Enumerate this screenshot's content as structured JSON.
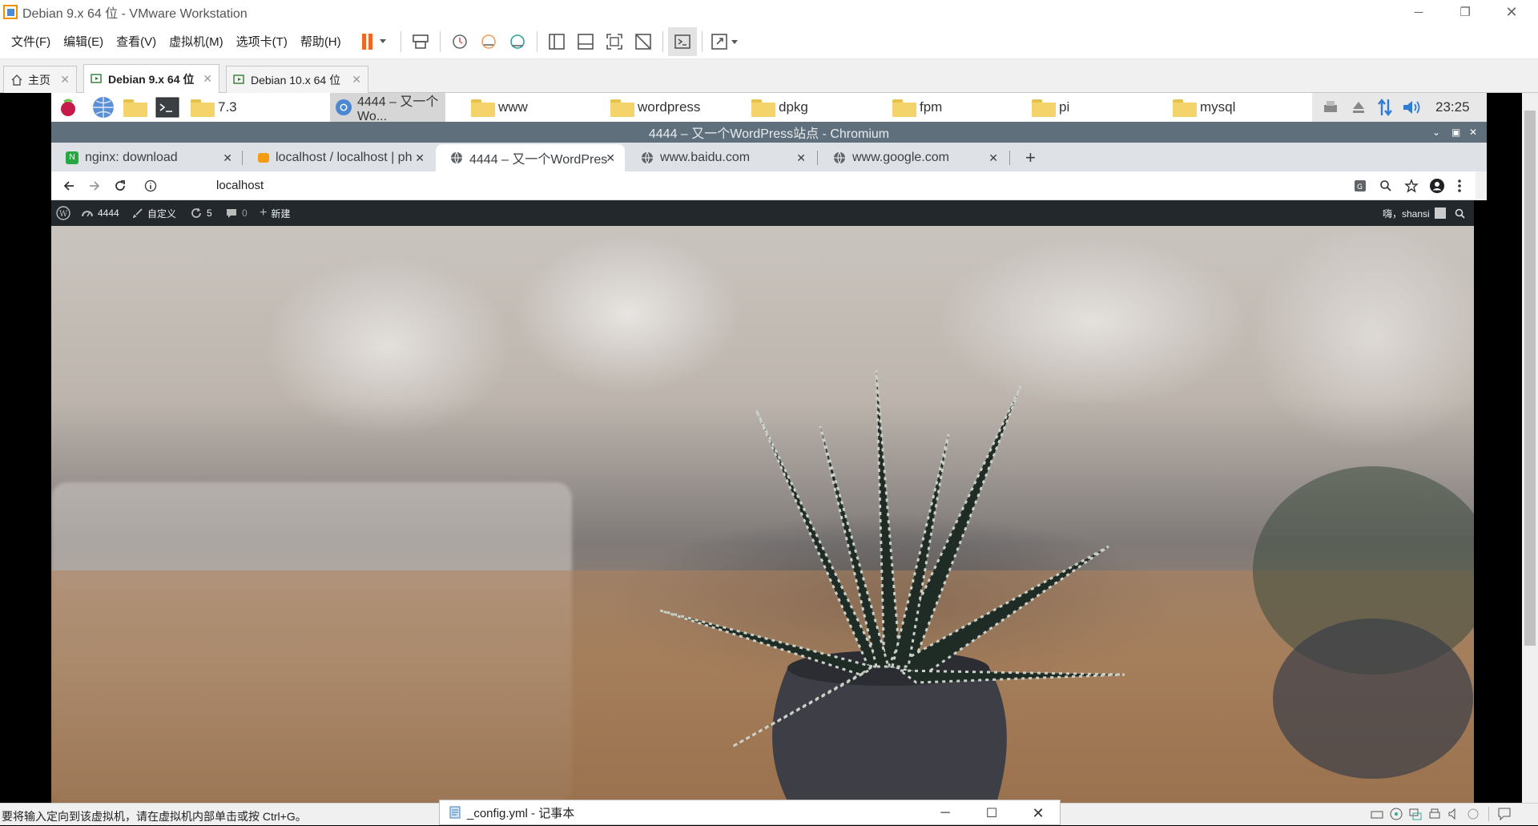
{
  "vmware": {
    "title": "Debian 9.x 64 位 - VMware Workstation",
    "menu": [
      "文件(F)",
      "编辑(E)",
      "查看(V)",
      "虚拟机(M)",
      "选项卡(T)",
      "帮助(H)"
    ],
    "tabs": [
      {
        "label": "主页"
      },
      {
        "label": "Debian 9.x 64 位"
      },
      {
        "label": "Debian 10.x 64 位"
      }
    ],
    "status_message": "要将输入定向到该虚拟机，请在虚拟机内部单击或按 Ctrl+G。"
  },
  "guest_panel": {
    "active_window": "4444 – 又一个Wo...",
    "folders": [
      "7.3",
      "www",
      "wordpress",
      "dpkg",
      "fpm",
      "pi",
      "mysql"
    ],
    "clock": "23:25"
  },
  "chromium": {
    "window_title": "4444 – 又一个WordPress站点 - Chromium",
    "tabs": [
      {
        "label": "nginx: download"
      },
      {
        "label": "localhost / localhost | ph"
      },
      {
        "label": "4444 – 又一个WordPres"
      },
      {
        "label": "www.baidu.com"
      },
      {
        "label": "www.google.com"
      }
    ],
    "url": "localhost"
  },
  "wp_admin": {
    "site": "4444",
    "customize": "自定义",
    "updates": "5",
    "comments": "0",
    "new": "新建",
    "greeting": "嗨，shansi"
  },
  "notepad": {
    "title": "_config.yml - 记事本"
  },
  "colors": {
    "wp_bar": "#23282d",
    "chrome_title": "#5f6f7c",
    "pause_orange": "#f26522"
  }
}
